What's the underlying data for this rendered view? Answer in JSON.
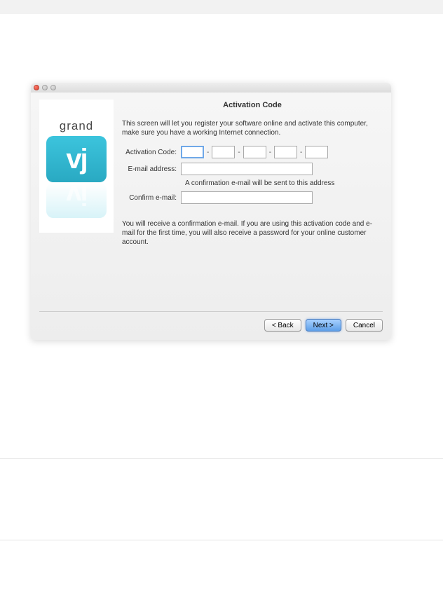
{
  "logo": {
    "text_top": "grand",
    "text_main": "vj"
  },
  "dialog": {
    "title": "Activation Code",
    "intro": "This screen will let you register your software online and activate this computer, make sure you have a working Internet connection.",
    "activation_label": "Activation Code:",
    "email_label": "E-mail address:",
    "email_hint": "A confirmation e-mail will be sent to this address",
    "confirm_label": "Confirm e-mail:",
    "note": "You will receive a confirmation e-mail. If you are using this activation code and e-mail for the first time, you will also receive a password for your online customer account.",
    "dash": "-"
  },
  "buttons": {
    "back": "< Back",
    "next": "Next >",
    "cancel": "Cancel"
  },
  "fields": {
    "code1": "",
    "code2": "",
    "code3": "",
    "code4": "",
    "code5": "",
    "email": "",
    "confirm_email": ""
  }
}
